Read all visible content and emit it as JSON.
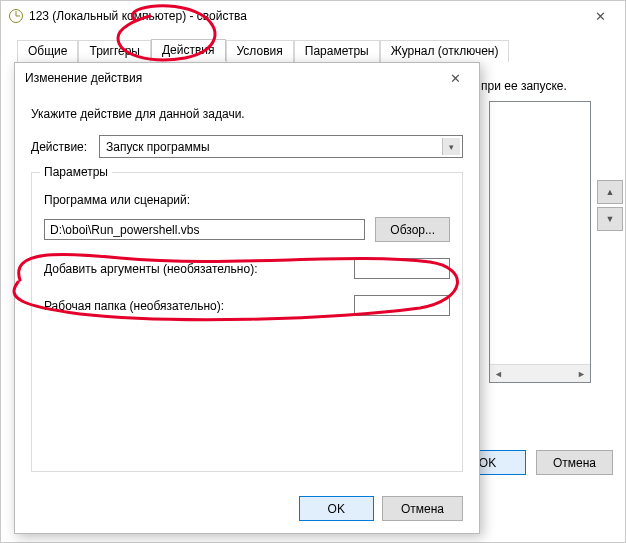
{
  "parent": {
    "title": "123 (Локальный компьютер) - свойства",
    "tabs": [
      "Общие",
      "Триггеры",
      "Действия",
      "Условия",
      "Параметры",
      "Журнал (отключен)"
    ],
    "active_tab_index": 2,
    "hint_fragment": "при ее запуске.",
    "ok": "OK",
    "cancel": "Отмена"
  },
  "dialog": {
    "title": "Изменение действия",
    "instruction": "Укажите действие для данной задачи.",
    "action_label": "Действие:",
    "action_value": "Запуск программы",
    "group_label": "Параметры",
    "program_label": "Программа или сценарий:",
    "program_value": "D:\\oboi\\Run_powershell.vbs",
    "browse": "Обзор...",
    "args_label": "Добавить аргументы (необязательно):",
    "args_value": "",
    "startin_label": "Рабочая папка (необязательно):",
    "startin_value": "",
    "ok": "OK",
    "cancel": "Отмена"
  }
}
